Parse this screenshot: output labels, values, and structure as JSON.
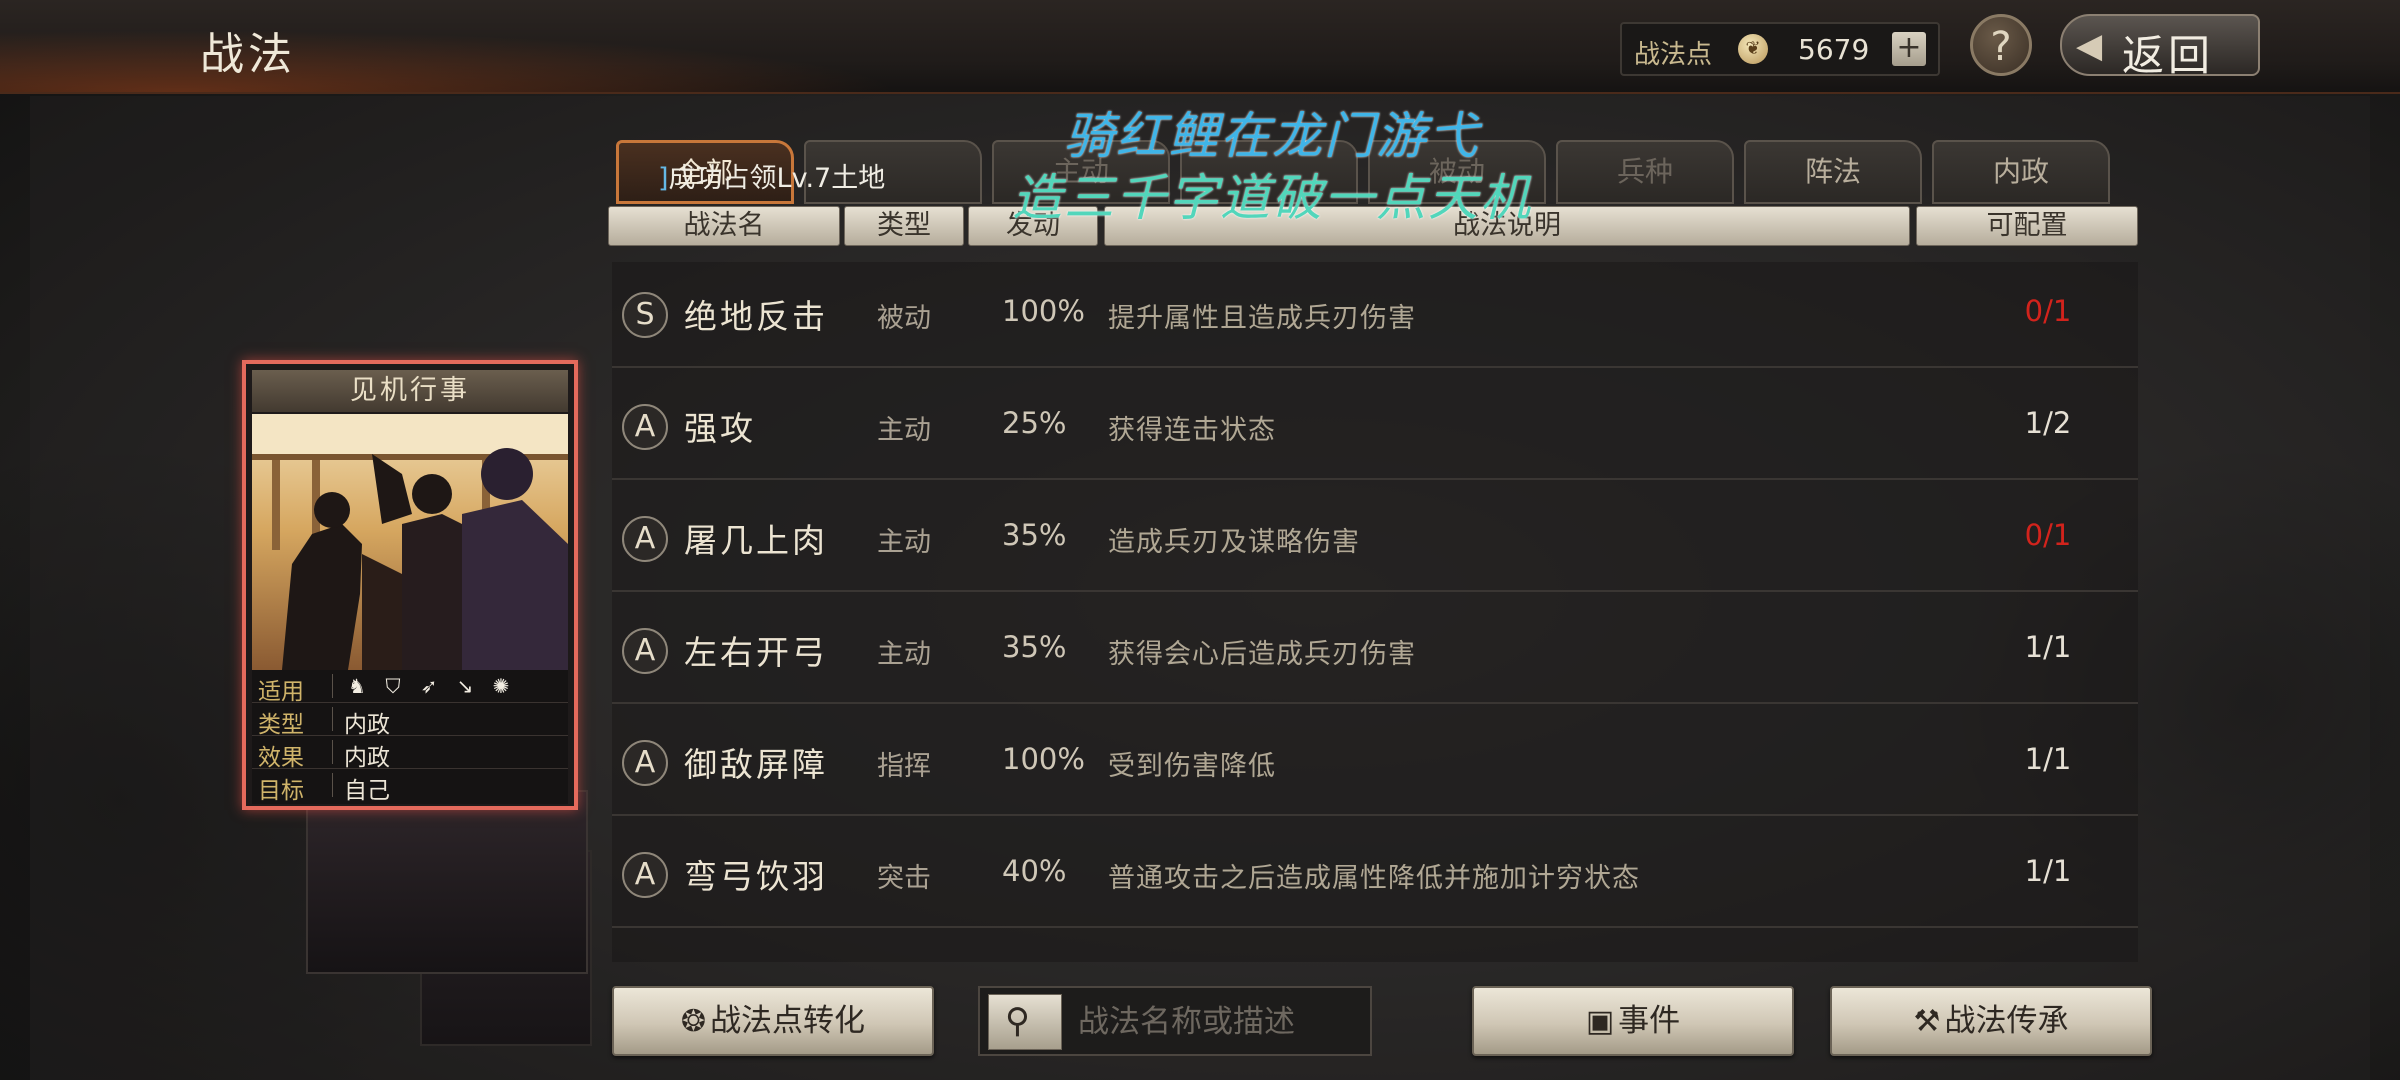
{
  "header": {
    "title": "战法",
    "points_label": "战法点",
    "points_value": "5679",
    "plus_label": "+",
    "help_label": "?",
    "back_label": "返回"
  },
  "tabs": [
    {
      "label": "全部",
      "active": true
    },
    {
      "label": "",
      "active": false
    },
    {
      "label": "主动",
      "active": false
    },
    {
      "label": "",
      "active": false
    },
    {
      "label": "被动",
      "active": false
    },
    {
      "label": "兵种",
      "active": false
    },
    {
      "label": "阵法",
      "active": false
    },
    {
      "label": "内政",
      "active": false
    }
  ],
  "columns": {
    "name": "战法名",
    "type": "类型",
    "rate": "发动",
    "desc": "战法说明",
    "avail": "可配置"
  },
  "skills": [
    {
      "grade": "S",
      "name": "绝地反击",
      "type": "被动",
      "rate": "100%",
      "desc": "提升属性且造成兵刃伤害",
      "avail": "0/1",
      "avail_color": "#d2231c"
    },
    {
      "grade": "A",
      "name": "强攻",
      "type": "主动",
      "rate": "25%",
      "desc": "获得连击状态",
      "avail": "1/2",
      "avail_color": "#e6e0d4"
    },
    {
      "grade": "A",
      "name": "屠几上肉",
      "type": "主动",
      "rate": "35%",
      "desc": "造成兵刃及谋略伤害",
      "avail": "0/1",
      "avail_color": "#d2231c"
    },
    {
      "grade": "A",
      "name": "左右开弓",
      "type": "主动",
      "rate": "35%",
      "desc": "获得会心后造成兵刃伤害",
      "avail": "1/1",
      "avail_color": "#e6e0d4"
    },
    {
      "grade": "A",
      "name": "御敌屏障",
      "type": "指挥",
      "rate": "100%",
      "desc": "受到伤害降低",
      "avail": "1/1",
      "avail_color": "#e6e0d4"
    },
    {
      "grade": "A",
      "name": "弯弓饮羽",
      "type": "突击",
      "rate": "40%",
      "desc": "普通攻击之后造成属性降低并施加计穷状态",
      "avail": "1/1",
      "avail_color": "#e6e0d4"
    }
  ],
  "card": {
    "title": "见机行事",
    "applicable_label": "适用",
    "type_label": "类型",
    "type_value": "内政",
    "effect_label": "效果",
    "effect_value": "内政",
    "target_label": "目标",
    "target_value": "自己",
    "troop_icons": [
      "cavalry-icon",
      "shield-icon",
      "bow-icon",
      "spear-icon",
      "wheel-icon"
    ]
  },
  "bottom": {
    "convert_label": "战法点转化",
    "search_placeholder": "战法名称或描述",
    "event_label": "事件",
    "inherit_label": "战法传承"
  },
  "overlay": {
    "notice_bracket": "]",
    "notice_text": "成功占领Lv.7土地",
    "watermark_line1": "骑红鲤在龙门游弋",
    "watermark_line2": "造三千字道破一点天机"
  }
}
